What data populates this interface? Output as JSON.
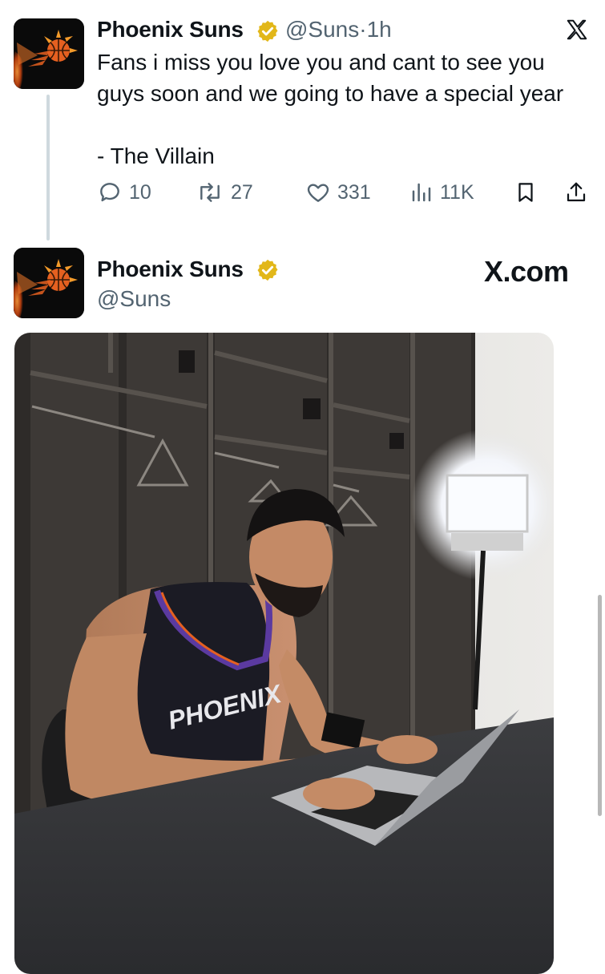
{
  "tweet": {
    "author_name": "Phoenix Suns",
    "handle": "@Suns",
    "separator": "·",
    "time": "1h",
    "text_lines": [
      "Fans i miss you love you and cant to see you",
      "guys soon and we going to have a special year",
      "",
      "- The Villain"
    ],
    "metrics": {
      "replies": "10",
      "retweets": "27",
      "likes": "331",
      "views": "11K"
    },
    "icons": [
      "reply-icon",
      "retweet-icon",
      "like-icon",
      "views-icon",
      "bookmark-icon",
      "share-icon",
      "x-logo-icon",
      "verified-badge-icon"
    ]
  },
  "quoted_card": {
    "author_name": "Phoenix Suns",
    "handle": "@Suns",
    "brand_text": "X.com"
  },
  "colors": {
    "verified_gold": "#e2b719",
    "text_primary": "#0f1419",
    "text_muted": "#536471",
    "suns_orange": "#e56020",
    "avatar_bg": "#0a0a0a"
  }
}
